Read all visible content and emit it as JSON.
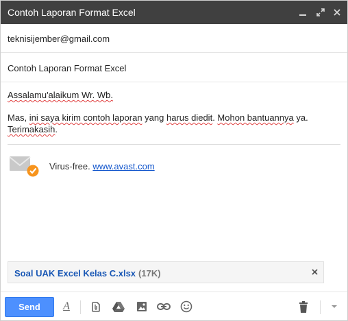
{
  "window": {
    "title": "Contoh Laporan Format Excel",
    "controls": [
      "minimize-icon",
      "maximize-icon",
      "close-icon"
    ]
  },
  "compose": {
    "to": "teknisijember@gmail.com",
    "subject": "Contoh Laporan Format Excel",
    "body": {
      "greeting": "Assalamu'alaikum Wr. Wb.",
      "message": [
        {
          "t": "Mas, ",
          "sq": false
        },
        {
          "t": "ini saya kirim contoh laporan",
          "sq": true
        },
        {
          "t": " yang ",
          "sq": false
        },
        {
          "t": "harus diedit",
          "sq": true
        },
        {
          "t": ". ",
          "sq": false
        },
        {
          "t": "Mohon bantuannya",
          "sq": true
        },
        {
          "t": " ya. ",
          "sq": false
        },
        {
          "t": "Terimakasih",
          "sq": true
        },
        {
          "t": ".",
          "sq": false
        }
      ]
    },
    "signature": {
      "label": "Virus-free.",
      "link": "www.avast.com",
      "icon": "avast-envelope-check-icon",
      "accent": "#f7941d"
    },
    "attachment": {
      "name": "Soal UAK Excel Kelas C.xlsx",
      "size": "(17K)"
    }
  },
  "toolbar": {
    "send_label": "Send",
    "send_color": "#4d90fe",
    "icons": [
      "formatting-icon",
      "attach-file-icon",
      "google-drive-icon",
      "insert-photo-icon",
      "insert-link-icon",
      "emoji-icon",
      "trash-icon",
      "more-options-icon"
    ]
  }
}
